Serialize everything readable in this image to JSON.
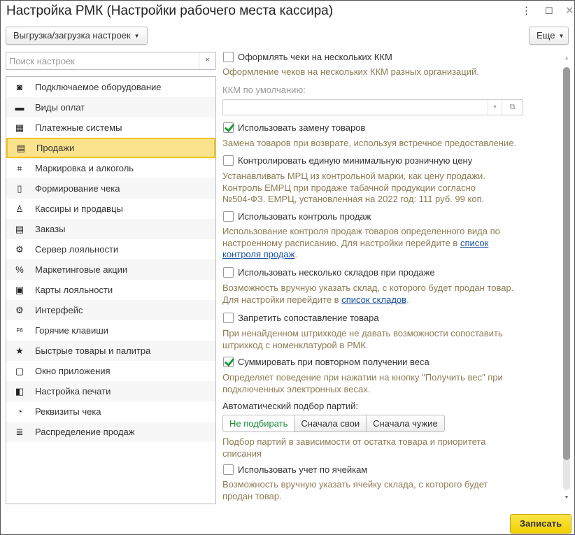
{
  "window": {
    "title": "Настройка РМК (Настройки рабочего места кассира)",
    "menu_icon": "⋮",
    "maximize_icon": "☐",
    "close_icon": "✕"
  },
  "toolbar": {
    "export_label": "Выгрузка/загрузка настроек",
    "more_label": "Еще"
  },
  "search": {
    "placeholder": "Поиск настроек",
    "clear": "×"
  },
  "sidebar": {
    "items": [
      {
        "label": "Подключаемое оборудование",
        "icon": "◙"
      },
      {
        "label": "Виды оплат",
        "icon": "▬"
      },
      {
        "label": "Платежные системы",
        "icon": "▦"
      },
      {
        "label": "Продажи",
        "icon": "▤"
      },
      {
        "label": "Маркировка и алкоголь",
        "icon": "⌗"
      },
      {
        "label": "Формирование чека",
        "icon": "▯"
      },
      {
        "label": "Кассиры и продавцы",
        "icon": "♙"
      },
      {
        "label": "Заказы",
        "icon": "▤"
      },
      {
        "label": "Сервер лояльности",
        "icon": "⚙"
      },
      {
        "label": "Маркетинговые акции",
        "icon": "%"
      },
      {
        "label": "Карты лояльности",
        "icon": "▣"
      },
      {
        "label": "Интерфейс",
        "icon": "⚙"
      },
      {
        "label": "Горячие клавиши",
        "icon": "F6"
      },
      {
        "label": "Быстрые товары и палитра",
        "icon": "★"
      },
      {
        "label": "Окно приложения",
        "icon": "▢"
      },
      {
        "label": "Настройка печати",
        "icon": "◧"
      },
      {
        "label": "Реквизиты чека",
        "icon": "◔"
      },
      {
        "label": "Распределение продаж",
        "icon": "≣"
      }
    ],
    "selected": "Продажи"
  },
  "settings": {
    "multi_kkm": {
      "label": "Оформлять чеки на нескольких ККМ",
      "checked": false,
      "hint": "Оформление чеков на нескольких ККМ разных организаций."
    },
    "default_kkm": {
      "label": "ККМ по умолчанию:",
      "value": ""
    },
    "replace": {
      "label": "Использовать замену товаров",
      "checked": true,
      "hint": "Замена товаров при возврате, используя встречное предоставление."
    },
    "emrc": {
      "label": "Контролировать единую минимальную розничную цену",
      "checked": false,
      "hint1": "Устанавливать МРЦ из контрольной марки, как цену продажи.",
      "hint2": "Контроль ЕМРЦ при продаже табачной продукции согласно",
      "hint3": "№504-ФЗ. ЕМРЦ, установленная на 2022 год: 111 руб. 99 коп."
    },
    "sales_control": {
      "label": "Использовать контроль продаж",
      "checked": false,
      "hint1": "Использование контроля продаж товаров определенного вида по",
      "hint2": "настроенному расписанию. Для настройки перейдите в ",
      "link1": "список",
      "link2": "контроля продаж",
      "hint3": "."
    },
    "warehouses": {
      "label": "Использовать несколько складов при продаже",
      "checked": false,
      "hint1": "Возможность вручную указать склад, с которого будет продан товар.",
      "hint2": "Для настройки перейдите в ",
      "link": "список складов",
      "hint3": "."
    },
    "no_match": {
      "label": "Запретить сопоставление товара",
      "checked": false,
      "hint1": "При ненайденном штрихкоде не давать возможности сопоставить",
      "hint2": "штрихкод с номенклатурой в РМК."
    },
    "weight": {
      "label": "Суммировать при повторном получении веса",
      "checked": true,
      "hint1": "Определяет поведение при нажатии на кнопку \"Получить вес\" при",
      "hint2": "подключенных электронных весах."
    },
    "batches": {
      "label": "Автоматический подбор партий:",
      "options": [
        "Не подбирать",
        "Сначала свои",
        "Сначала чужие"
      ],
      "selected": "Не подбирать",
      "hint1": "Подбор партий в зависимости от остатка товара и приоритета",
      "hint2": "списания"
    },
    "cells": {
      "label": "Использовать учет по ячейкам",
      "checked": false,
      "hint1": "Возможность вручную указать ячейку склада, с которого будет",
      "hint2": "продан товар."
    }
  },
  "footer": {
    "save_label": "Записать"
  },
  "colors": {
    "accent": "#f3c41b",
    "hint": "#8c7b55",
    "link": "#1a4fa0",
    "check": "#1a9a3a"
  }
}
